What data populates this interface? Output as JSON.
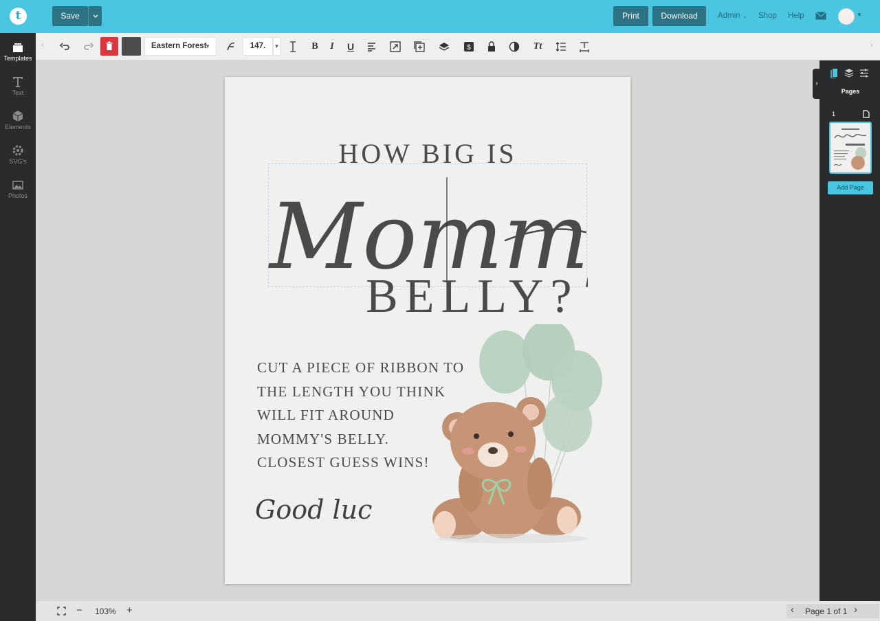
{
  "topbar": {
    "logo_letter": "t",
    "save_label": "Save",
    "print_label": "Print",
    "download_label": "Download",
    "admin_label": "Admin",
    "shop_label": "Shop",
    "help_label": "Help",
    "accent_color": "#4ac6e1"
  },
  "sidebar": {
    "items": [
      {
        "label": "Templates",
        "icon": "templates-icon",
        "active": true
      },
      {
        "label": "Text",
        "icon": "text-icon"
      },
      {
        "label": "Elements",
        "icon": "elements-icon"
      },
      {
        "label": "SVG's",
        "icon": "svg-icon"
      },
      {
        "label": "Photos",
        "icon": "photos-icon"
      }
    ]
  },
  "toolbar": {
    "font_name": "Eastern Forest",
    "font_size": "147.",
    "text_color": "#4d4e4c",
    "delete_color": "#d9363e"
  },
  "canvas": {
    "heading_line1": "HOW BIG IS",
    "heading_script": "Mommy's",
    "heading_line3": "BELLY?",
    "instructions": [
      "CUT A PIECE OF RIBBON TO",
      "THE LENGTH YOU THINK",
      "WILL FIT AROUND",
      "MOMMY'S BELLY.",
      "CLOSEST GUESS WINS!"
    ],
    "signoff": "Good luck!"
  },
  "right_panel": {
    "title": "Pages",
    "page_number": "1",
    "add_page_label": "Add Page"
  },
  "bottombar": {
    "zoom": "103%",
    "page_indicator": "Page 1 of 1"
  }
}
